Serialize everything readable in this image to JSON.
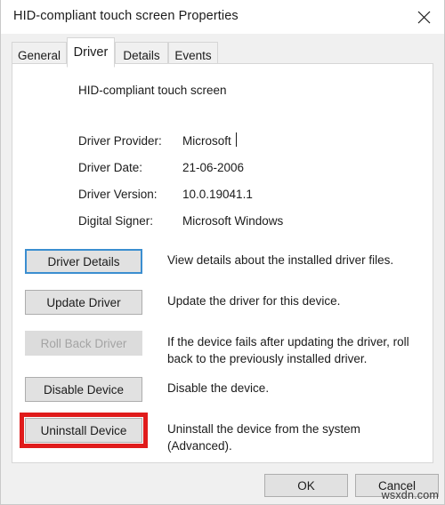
{
  "window": {
    "title": "HID-compliant touch screen  Properties",
    "close_icon": "close-icon"
  },
  "tabs": [
    {
      "label": "General",
      "active": false
    },
    {
      "label": "Driver",
      "active": true
    },
    {
      "label": "Details",
      "active": false
    },
    {
      "label": "Events",
      "active": false
    }
  ],
  "content": {
    "device_name": "HID-compliant touch screen",
    "info_rows": [
      {
        "label": "Driver Provider:",
        "value": "Microsoft"
      },
      {
        "label": "Driver Date:",
        "value": "21-06-2006"
      },
      {
        "label": "Driver Version:",
        "value": "10.0.19041.1"
      },
      {
        "label": "Digital Signer:",
        "value": "Microsoft Windows"
      }
    ],
    "actions": [
      {
        "button": "Driver Details",
        "description": "View details about the installed driver files.",
        "state": "focused"
      },
      {
        "button": "Update Driver",
        "description": "Update the driver for this device.",
        "state": "normal"
      },
      {
        "button": "Roll Back Driver",
        "description": "If the device fails after updating the driver, roll back to the previously installed driver.",
        "state": "disabled"
      },
      {
        "button": "Disable Device",
        "description": "Disable the device.",
        "state": "normal"
      },
      {
        "button": "Uninstall Device",
        "description": "Uninstall the device from the system (Advanced).",
        "state": "highlighted"
      }
    ]
  },
  "footer": {
    "ok_label": "OK",
    "cancel_label": "Cancel"
  },
  "watermark": "wsxdn.com",
  "colors": {
    "highlight_red": "#e01b1b",
    "focus_blue": "#3b8ed0",
    "dialog_bg": "#f0f0f0",
    "panel_bg": "#ffffff"
  }
}
